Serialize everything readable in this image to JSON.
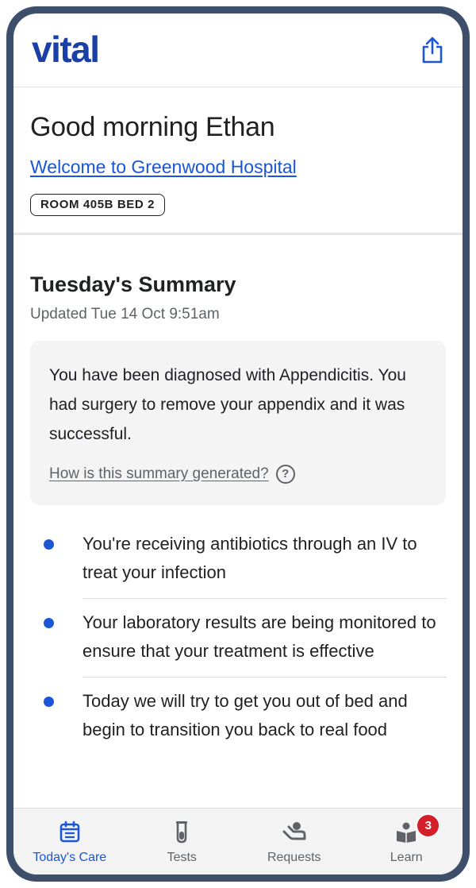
{
  "header": {
    "logo": "vital",
    "share_icon": "share-icon"
  },
  "greeting": {
    "title": "Good morning Ethan",
    "welcome_link": "Welcome to Greenwood Hospital",
    "room_badge": "ROOM 405B BED 2"
  },
  "summary": {
    "title": "Tuesday's Summary",
    "updated": "Updated Tue 14 Oct 9:51am",
    "text": "You have been diagnosed with Appendicitis. You had surgery to remove your appendix and it was successful.",
    "how_link": "How is this summary generated?",
    "help_icon": "?"
  },
  "bullets": [
    {
      "text": "You're receiving antibiotics through an IV to treat your infection"
    },
    {
      "text": "Your laboratory results are being monitored to ensure that your treatment is effective"
    },
    {
      "text": "Today we will try to get you out of bed and begin to transition you back to real food"
    }
  ],
  "nav": {
    "items": [
      {
        "label": "Today's Care",
        "icon": "calendar-icon",
        "active": true
      },
      {
        "label": "Tests",
        "icon": "test-tube-icon"
      },
      {
        "label": "Requests",
        "icon": "hand-person-icon"
      },
      {
        "label": "Learn",
        "icon": "book-reader-icon",
        "badge": "3"
      }
    ]
  },
  "colors": {
    "brand": "#1a3fa6",
    "link": "#1a56d6",
    "badge": "#d41f2a",
    "frame": "#3d4f6b"
  }
}
